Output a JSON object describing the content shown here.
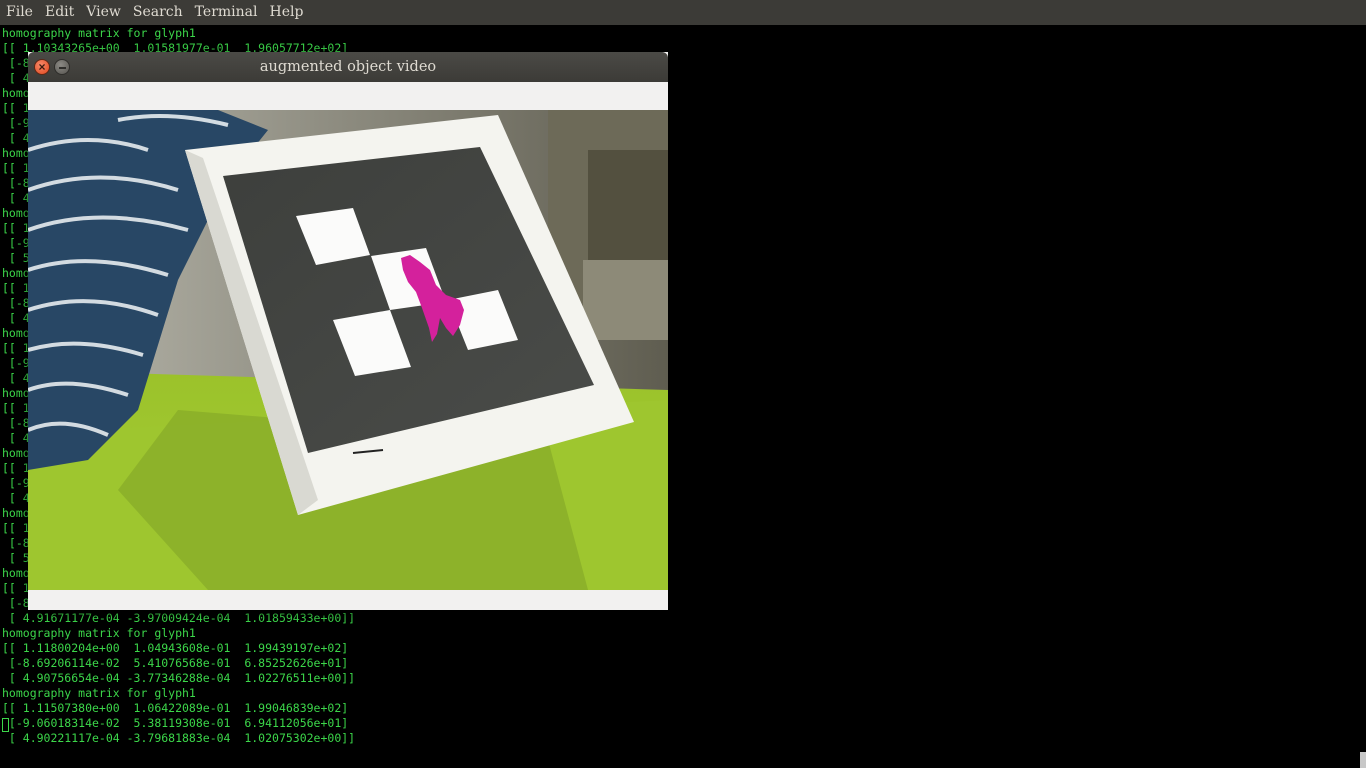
{
  "menubar": {
    "items": [
      "File",
      "Edit",
      "View",
      "Search",
      "Terminal",
      "Help"
    ]
  },
  "window": {
    "title": "augmented object video",
    "close_icon": "close-icon",
    "minimize_icon": "minimize-icon"
  },
  "terminal": {
    "lines": [
      "homography matrix for glyph1",
      "[[ 1.10343265e+00  1.01581977e-01  1.96057712e+02]",
      " [-8",
      " [ 4",
      "homo",
      "[[ 1",
      " [-9",
      " [ 4",
      "homo",
      "[[ 1",
      " [-8",
      " [ 4",
      "homo",
      "[[ 1",
      " [-9",
      " [ 5",
      "homo",
      "[[ 1",
      " [-8",
      " [ 4",
      "homo",
      "[[ 1",
      " [-9",
      " [ 4",
      "homo",
      "[[ 1",
      " [-8",
      " [ 4",
      "homo",
      "[[ 1",
      " [-9",
      " [ 4",
      "homo",
      "[[ 1",
      " [-8",
      " [ 5",
      "homo",
      "[[ 1",
      " [-8",
      " [ 4.91671177e-04 -3.97009424e-04  1.01859433e+00]]",
      "homography matrix for glyph1",
      "[[ 1.11800204e+00  1.04943608e-01  1.99439197e+02]",
      " [-8.69206114e-02  5.41076568e-01  6.85252626e+01]",
      " [ 4.90756654e-04 -3.77346288e-04  1.02276511e+00]]",
      "homography matrix for glyph1",
      "[[ 1.11507380e+00  1.06422089e-01  1.99046839e+02]",
      " [-9.06018314e-02  5.38119308e-01  6.94112056e+01]",
      " [ 4.90221117e-04 -3.79681883e-04  1.02075302e+00]]"
    ],
    "text_color": "#3cd64a",
    "background": "#000000"
  },
  "colors": {
    "menubar_bg": "#3c3b37",
    "menubar_text": "#dfdbd2",
    "augmented_object": "#d4219c"
  }
}
